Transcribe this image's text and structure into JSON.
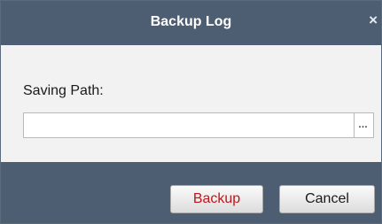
{
  "dialog": {
    "title": "Backup Log",
    "close_glyph": "×",
    "saving_path_label": "Saving Path:",
    "saving_path_value": "",
    "browse_label": "…",
    "buttons": {
      "backup": "Backup",
      "cancel": "Cancel"
    }
  },
  "colors": {
    "titlebar": "#4d5e72",
    "body": "#f2f2f2",
    "backup_text": "#c0151b"
  },
  "icons": {
    "close": "close-icon",
    "browse": "ellipsis-icon"
  }
}
